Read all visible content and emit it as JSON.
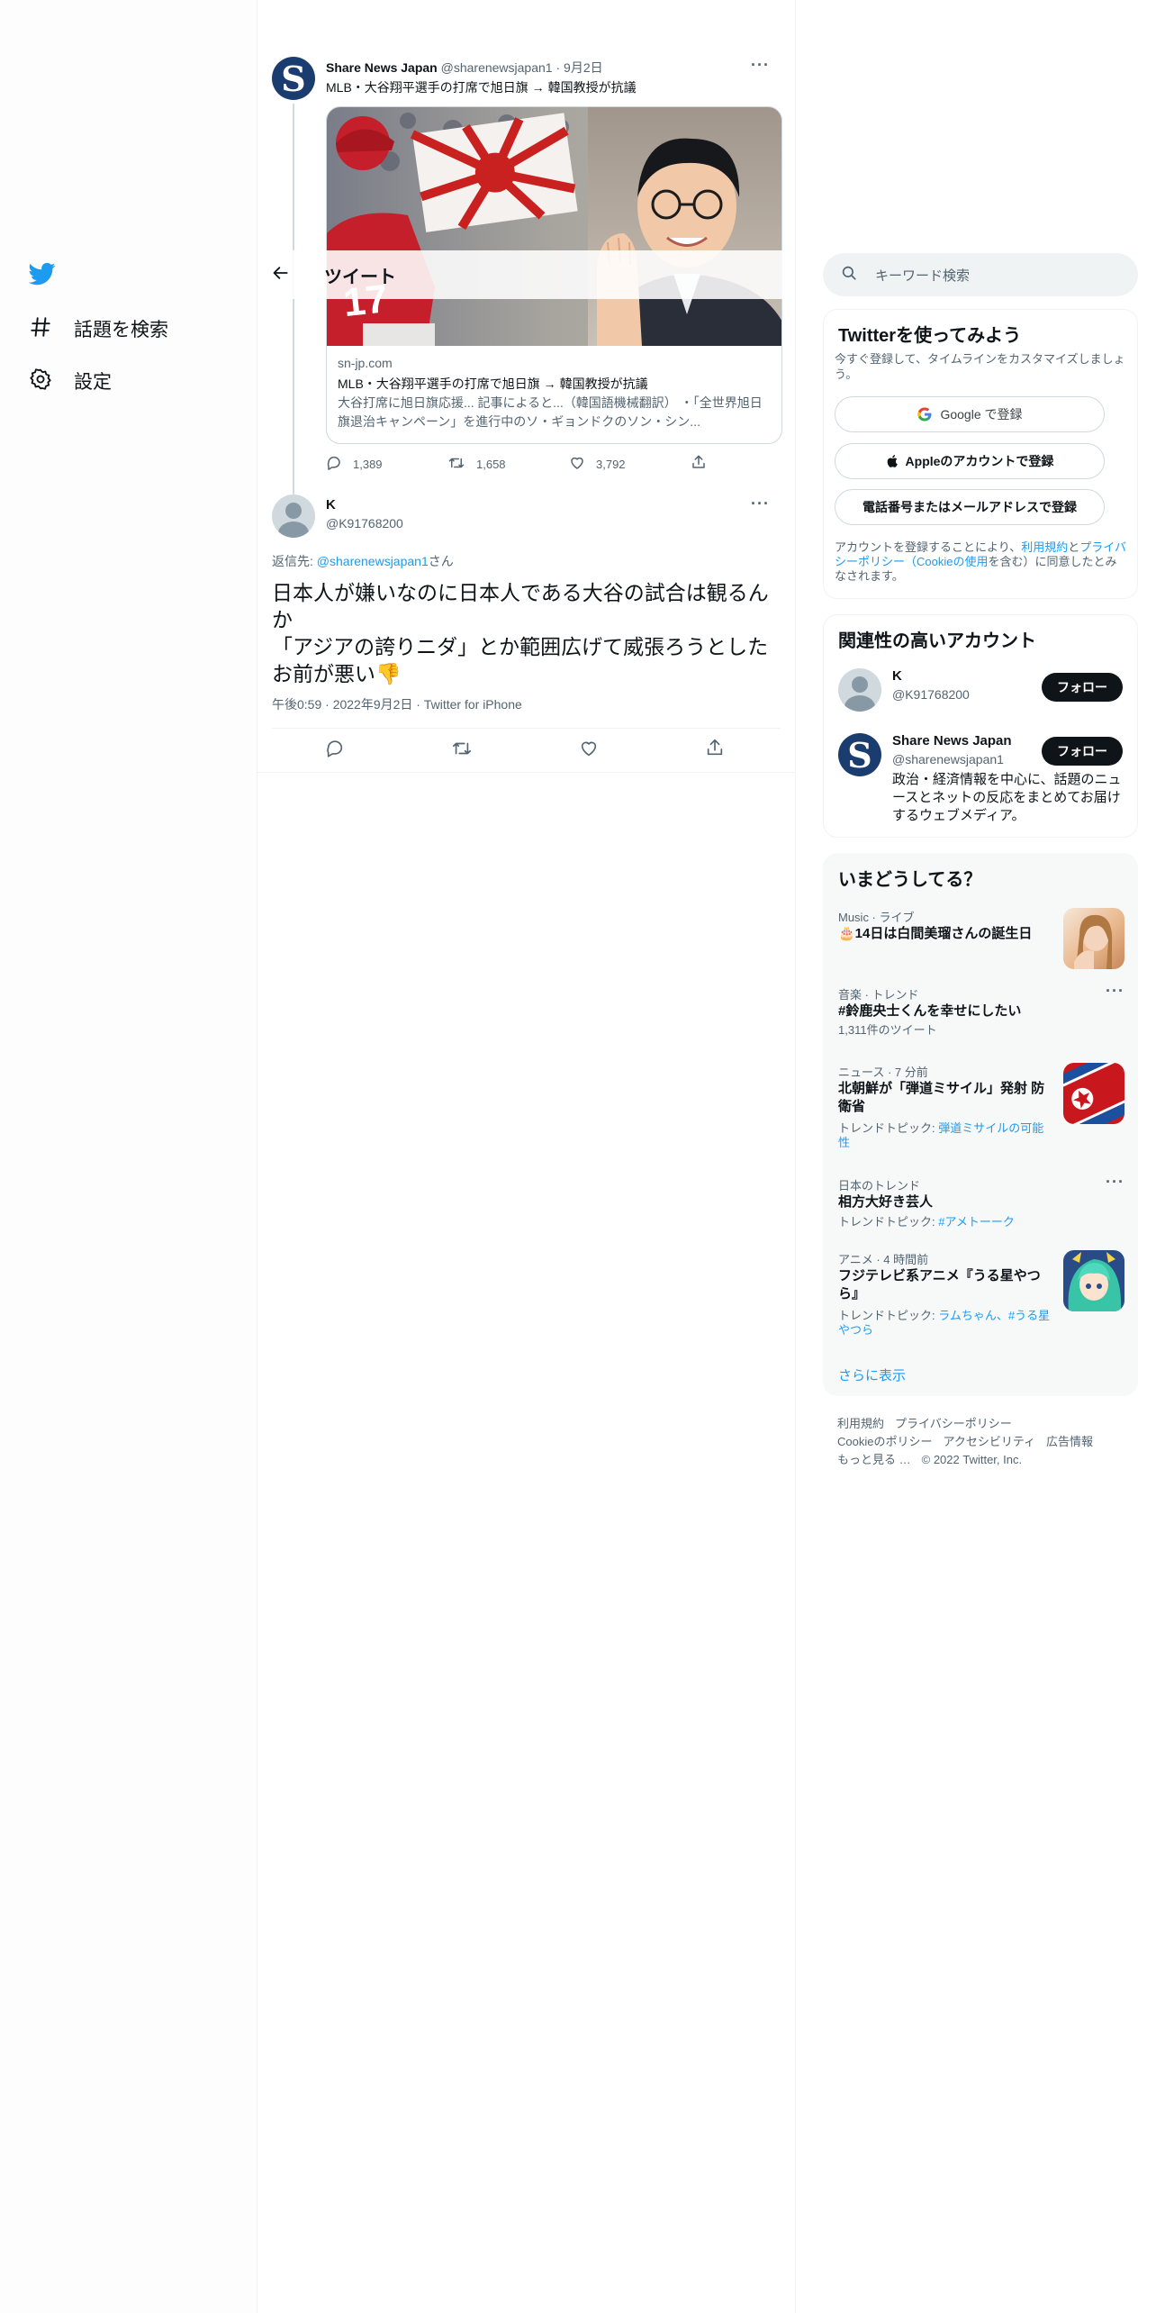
{
  "nav": {
    "items": [
      {
        "label": "話題を検索",
        "icon": "hashtag-icon"
      },
      {
        "label": "設定",
        "icon": "gear-icon"
      }
    ]
  },
  "header": {
    "title": "ツイート"
  },
  "quoted_tweet": {
    "name": "Share News Japan",
    "handle": "@sharenewsjapan1",
    "date": "9月2日",
    "text": "MLB・大谷翔平選手の打席で旭日旗 → 韓国教授が抗議",
    "card": {
      "domain": "sn-jp.com",
      "title": "MLB・大谷翔平選手の打席で旭日旗 → 韓国教授が抗議",
      "desc": "大谷打席に旭日旗応援... 記事によると...（韓国語機械翻訳） ・「全世界旭日旗退治キャンペーン」を進行中のソ・ギョンドクのソン・シン...",
      "jersey_number": "17"
    },
    "counts": {
      "replies": "1,389",
      "retweets": "1,658",
      "likes": "3,792"
    }
  },
  "main_tweet": {
    "name": "K",
    "handle": "@K91768200",
    "reply_prefix": "返信先: ",
    "reply_to": "@sharenewsjapan1",
    "reply_suffix": "さん",
    "line1": "日本人が嫌いなのに日本人である大谷の試合は観るんか",
    "line2": "「アジアの誇りニダ」とか範囲広げて威張ろうとしたお前が悪い",
    "emoji": "👎",
    "meta": "午後0:59 · 2022年9月2日 · Twitter for iPhone"
  },
  "right": {
    "search_placeholder": "キーワード検索",
    "signup": {
      "title": "Twitterを使ってみよう",
      "subtitle": "今すぐ登録して、タイムラインをカスタマイズしましょう。",
      "google": "Google で登録",
      "apple": "Appleのアカウントで登録",
      "phone": "電話番号またはメールアドレスで登録",
      "legal_1": "アカウントを登録することにより、",
      "legal_terms": "利用規約",
      "legal_and": "と",
      "legal_privacy": "プライバシーポリシー",
      "legal_paren_open": "（",
      "legal_cookie": "Cookieの使用",
      "legal_2": "を含む）に同意したとみなされます。"
    },
    "relevant": {
      "title": "関連性の高いアカウント",
      "accounts": [
        {
          "name": "K",
          "handle": "@K91768200",
          "bio": "",
          "follow": "フォロー"
        },
        {
          "name": "Share News Japan",
          "handle": "@sharenewsjapan1",
          "bio": "政治・経済情報を中心に、話題のニュースとネットの反応をまとめてお届けするウェブメディア。",
          "follow": "フォロー"
        }
      ]
    },
    "trends": {
      "title": "いまどうしてる？",
      "items": [
        {
          "meta": "Music · ライブ",
          "name": "🎂14日は白間美瑠さんの誕生日"
        },
        {
          "meta": "音楽 · トレンド",
          "name": "#鈴鹿央士くんを幸せにしたい",
          "sub": "1,311件のツイート"
        },
        {
          "meta": "ニュース · 7 分前",
          "name": "北朝鮮が「弾道ミサイル」発射 防衛省",
          "sub_label": "トレンドトピック: ",
          "sub_link": "弾道ミサイルの可能性"
        },
        {
          "meta": "日本のトレンド",
          "name": "相方大好き芸人",
          "sub_label": "トレンドトピック: ",
          "sub_link": "#アメトーーク"
        },
        {
          "meta": "アニメ · 4 時間前",
          "name": "フジテレビ系アニメ『うる星やつら』",
          "sub_label": "トレンドトピック: ",
          "sub_link": "ラムちゃん、#うる星やつら"
        }
      ],
      "show_more": "さらに表示"
    },
    "footer": {
      "terms": "利用規約",
      "privacy": "プライバシーポリシー",
      "cookie": "Cookieのポリシー",
      "accessibility": "アクセシビリティ",
      "ads": "広告情報",
      "more": "もっと見る …",
      "copyright": "© 2022 Twitter, Inc."
    }
  },
  "colors": {
    "accent": "#1d9bf0",
    "text": "#0f1419",
    "muted": "#536471",
    "avatar_s": "#1b3c6e"
  }
}
